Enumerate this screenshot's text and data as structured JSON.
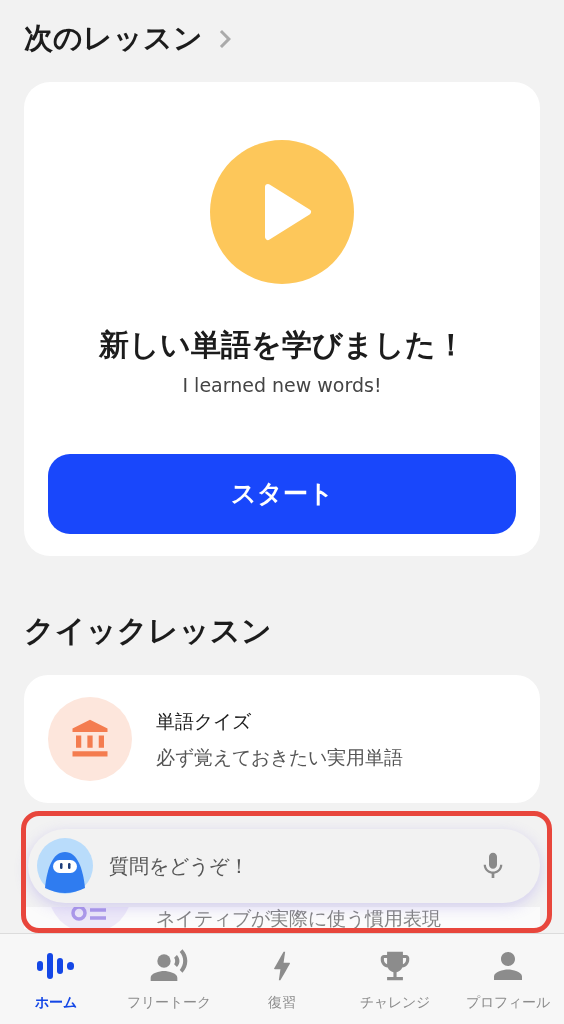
{
  "next_lesson": {
    "heading": "次のレッスン",
    "card": {
      "title": "新しい単語を学びました！",
      "subtitle": "I learned new words!",
      "button": "スタート"
    }
  },
  "quick_lessons": {
    "heading": "クイックレッスン",
    "items": [
      {
        "kind": "quiz",
        "title": "単語クイズ",
        "subtitle": "必ず覚えておきたい実用単語"
      },
      {
        "kind": "idiom",
        "subtitle": "ネイティブが実際に使う慣用表現"
      }
    ]
  },
  "ask_bar": {
    "placeholder": "質問をどうぞ！",
    "highlighted": true
  },
  "tab_bar": [
    {
      "label": "ホーム",
      "selected": true
    },
    {
      "label": "フリートーク",
      "selected": false
    },
    {
      "label": "復習",
      "selected": false
    },
    {
      "label": "チャレンジ",
      "selected": false
    },
    {
      "label": "プロフィール",
      "selected": false
    }
  ]
}
